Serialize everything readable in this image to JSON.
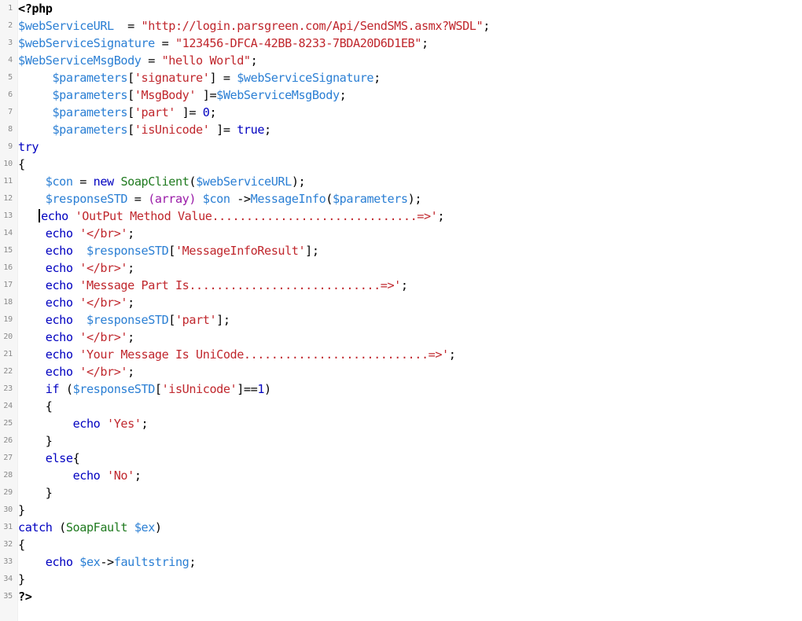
{
  "document": {
    "kind": "source-code-listing",
    "language": "PHP",
    "total_lines": 35,
    "caret_line": 13,
    "colors": {
      "background": "#ffffff",
      "gutter_background": "#f6f6f6",
      "line_number": "#8a8a8a",
      "variable": "#2b7fd4",
      "string": "#c0272d",
      "keyword": "#0000c0",
      "class_name": "#1f7a1f",
      "cast": "#9a1ba8",
      "plain": "#000000"
    }
  },
  "code": {
    "lines": [
      {
        "number": "1",
        "text": "<?php",
        "tokens": [
          {
            "t": "<?php",
            "c": "tok-tag"
          }
        ]
      },
      {
        "number": "2",
        "text": "$webServiceURL  = \"http://login.parsgreen.com/Api/SendSMS.asmx?WSDL\";",
        "tokens": [
          {
            "t": "$webServiceURL",
            "c": "tok-var"
          },
          {
            "t": "  = ",
            "c": "tok-plain"
          },
          {
            "t": "\"http://login.parsgreen.com/Api/SendSMS.asmx?WSDL\"",
            "c": "tok-string"
          },
          {
            "t": ";",
            "c": "tok-punc"
          }
        ]
      },
      {
        "number": "3",
        "text": "$webServiceSignature = \"123456-DFCA-42BB-8233-7BDA20D6D1EB\";",
        "tokens": [
          {
            "t": "$webServiceSignature",
            "c": "tok-var"
          },
          {
            "t": " = ",
            "c": "tok-plain"
          },
          {
            "t": "\"123456-DFCA-42BB-8233-7BDA20D6D1EB\"",
            "c": "tok-string"
          },
          {
            "t": ";",
            "c": "tok-punc"
          }
        ]
      },
      {
        "number": "4",
        "text": "$WebServiceMsgBody = \"hello World\";",
        "tokens": [
          {
            "t": "$WebServiceMsgBody",
            "c": "tok-var"
          },
          {
            "t": " = ",
            "c": "tok-plain"
          },
          {
            "t": "\"hello World\"",
            "c": "tok-string"
          },
          {
            "t": ";",
            "c": "tok-punc"
          }
        ]
      },
      {
        "number": "5",
        "text": "     $parameters['signature'] = $webServiceSignature;",
        "tokens": [
          {
            "t": "     ",
            "c": "tok-plain"
          },
          {
            "t": "$parameters",
            "c": "tok-var"
          },
          {
            "t": "[",
            "c": "tok-punc"
          },
          {
            "t": "'signature'",
            "c": "tok-string"
          },
          {
            "t": "] = ",
            "c": "tok-punc"
          },
          {
            "t": "$webServiceSignature",
            "c": "tok-var"
          },
          {
            "t": ";",
            "c": "tok-punc"
          }
        ]
      },
      {
        "number": "6",
        "text": "     $parameters['MsgBody' ]=$WebServiceMsgBody;",
        "tokens": [
          {
            "t": "     ",
            "c": "tok-plain"
          },
          {
            "t": "$parameters",
            "c": "tok-var"
          },
          {
            "t": "[",
            "c": "tok-punc"
          },
          {
            "t": "'MsgBody'",
            "c": "tok-string"
          },
          {
            "t": " ]=",
            "c": "tok-punc"
          },
          {
            "t": "$WebServiceMsgBody",
            "c": "tok-var"
          },
          {
            "t": ";",
            "c": "tok-punc"
          }
        ]
      },
      {
        "number": "7",
        "text": "     $parameters['part' ]= 0;",
        "tokens": [
          {
            "t": "     ",
            "c": "tok-plain"
          },
          {
            "t": "$parameters",
            "c": "tok-var"
          },
          {
            "t": "[",
            "c": "tok-punc"
          },
          {
            "t": "'part'",
            "c": "tok-string"
          },
          {
            "t": " ]= ",
            "c": "tok-punc"
          },
          {
            "t": "0",
            "c": "tok-number"
          },
          {
            "t": ";",
            "c": "tok-punc"
          }
        ]
      },
      {
        "number": "8",
        "text": "     $parameters['isUnicode' ]= true;",
        "tokens": [
          {
            "t": "     ",
            "c": "tok-plain"
          },
          {
            "t": "$parameters",
            "c": "tok-var"
          },
          {
            "t": "[",
            "c": "tok-punc"
          },
          {
            "t": "'isUnicode'",
            "c": "tok-string"
          },
          {
            "t": " ]= ",
            "c": "tok-punc"
          },
          {
            "t": "true",
            "c": "tok-const"
          },
          {
            "t": ";",
            "c": "tok-punc"
          }
        ]
      },
      {
        "number": "9",
        "text": "try",
        "tokens": [
          {
            "t": "try",
            "c": "tok-keyword"
          }
        ]
      },
      {
        "number": "10",
        "text": "{",
        "tokens": [
          {
            "t": "{",
            "c": "tok-punc"
          }
        ]
      },
      {
        "number": "11",
        "text": "    $con = new SoapClient($webServiceURL);",
        "tokens": [
          {
            "t": "    ",
            "c": "tok-plain"
          },
          {
            "t": "$con",
            "c": "tok-var"
          },
          {
            "t": " = ",
            "c": "tok-plain"
          },
          {
            "t": "new",
            "c": "tok-keyword"
          },
          {
            "t": " ",
            "c": "tok-plain"
          },
          {
            "t": "SoapClient",
            "c": "tok-class"
          },
          {
            "t": "(",
            "c": "tok-punc"
          },
          {
            "t": "$webServiceURL",
            "c": "tok-var"
          },
          {
            "t": ");",
            "c": "tok-punc"
          }
        ]
      },
      {
        "number": "12",
        "text": "    $responseSTD = (array) $con ->MessageInfo($parameters);",
        "tokens": [
          {
            "t": "    ",
            "c": "tok-plain"
          },
          {
            "t": "$responseSTD",
            "c": "tok-var"
          },
          {
            "t": " = ",
            "c": "tok-plain"
          },
          {
            "t": "(array)",
            "c": "tok-cast"
          },
          {
            "t": " ",
            "c": "tok-plain"
          },
          {
            "t": "$con",
            "c": "tok-var"
          },
          {
            "t": " ->",
            "c": "tok-punc"
          },
          {
            "t": "MessageInfo",
            "c": "tok-method"
          },
          {
            "t": "(",
            "c": "tok-punc"
          },
          {
            "t": "$parameters",
            "c": "tok-var"
          },
          {
            "t": ");",
            "c": "tok-punc"
          }
        ]
      },
      {
        "number": "13",
        "text": "    echo 'OutPut Method Value..............................=>';",
        "caret": true,
        "tokens": [
          {
            "t": "   ",
            "c": "tok-plain"
          },
          {
            "t": "echo",
            "c": "tok-keyword"
          },
          {
            "t": " ",
            "c": "tok-plain"
          },
          {
            "t": "'OutPut Method Value..............................=>'",
            "c": "tok-string"
          },
          {
            "t": ";",
            "c": "tok-punc"
          }
        ]
      },
      {
        "number": "14",
        "text": "    echo '</br>';",
        "tokens": [
          {
            "t": "    ",
            "c": "tok-plain"
          },
          {
            "t": "echo",
            "c": "tok-keyword"
          },
          {
            "t": " ",
            "c": "tok-plain"
          },
          {
            "t": "'</br>'",
            "c": "tok-string"
          },
          {
            "t": ";",
            "c": "tok-punc"
          }
        ]
      },
      {
        "number": "15",
        "text": "    echo  $responseSTD['MessageInfoResult'];",
        "tokens": [
          {
            "t": "    ",
            "c": "tok-plain"
          },
          {
            "t": "echo",
            "c": "tok-keyword"
          },
          {
            "t": "  ",
            "c": "tok-plain"
          },
          {
            "t": "$responseSTD",
            "c": "tok-var"
          },
          {
            "t": "[",
            "c": "tok-punc"
          },
          {
            "t": "'MessageInfoResult'",
            "c": "tok-string"
          },
          {
            "t": "];",
            "c": "tok-punc"
          }
        ]
      },
      {
        "number": "16",
        "text": "    echo '</br>';",
        "tokens": [
          {
            "t": "    ",
            "c": "tok-plain"
          },
          {
            "t": "echo",
            "c": "tok-keyword"
          },
          {
            "t": " ",
            "c": "tok-plain"
          },
          {
            "t": "'</br>'",
            "c": "tok-string"
          },
          {
            "t": ";",
            "c": "tok-punc"
          }
        ]
      },
      {
        "number": "17",
        "text": "    echo 'Message Part Is............................=>';",
        "tokens": [
          {
            "t": "    ",
            "c": "tok-plain"
          },
          {
            "t": "echo",
            "c": "tok-keyword"
          },
          {
            "t": " ",
            "c": "tok-plain"
          },
          {
            "t": "'Message Part Is............................=>'",
            "c": "tok-string"
          },
          {
            "t": ";",
            "c": "tok-punc"
          }
        ]
      },
      {
        "number": "18",
        "text": "    echo '</br>';",
        "tokens": [
          {
            "t": "    ",
            "c": "tok-plain"
          },
          {
            "t": "echo",
            "c": "tok-keyword"
          },
          {
            "t": " ",
            "c": "tok-plain"
          },
          {
            "t": "'</br>'",
            "c": "tok-string"
          },
          {
            "t": ";",
            "c": "tok-punc"
          }
        ]
      },
      {
        "number": "19",
        "text": "    echo  $responseSTD['part'];",
        "tokens": [
          {
            "t": "    ",
            "c": "tok-plain"
          },
          {
            "t": "echo",
            "c": "tok-keyword"
          },
          {
            "t": "  ",
            "c": "tok-plain"
          },
          {
            "t": "$responseSTD",
            "c": "tok-var"
          },
          {
            "t": "[",
            "c": "tok-punc"
          },
          {
            "t": "'part'",
            "c": "tok-string"
          },
          {
            "t": "];",
            "c": "tok-punc"
          }
        ]
      },
      {
        "number": "20",
        "text": "    echo '</br>';",
        "tokens": [
          {
            "t": "    ",
            "c": "tok-plain"
          },
          {
            "t": "echo",
            "c": "tok-keyword"
          },
          {
            "t": " ",
            "c": "tok-plain"
          },
          {
            "t": "'</br>'",
            "c": "tok-string"
          },
          {
            "t": ";",
            "c": "tok-punc"
          }
        ]
      },
      {
        "number": "21",
        "text": "    echo 'Your Message Is UniCode...........................=>';",
        "tokens": [
          {
            "t": "    ",
            "c": "tok-plain"
          },
          {
            "t": "echo",
            "c": "tok-keyword"
          },
          {
            "t": " ",
            "c": "tok-plain"
          },
          {
            "t": "'Your Message Is UniCode...........................=>'",
            "c": "tok-string"
          },
          {
            "t": ";",
            "c": "tok-punc"
          }
        ]
      },
      {
        "number": "22",
        "text": "    echo '</br>';",
        "tokens": [
          {
            "t": "    ",
            "c": "tok-plain"
          },
          {
            "t": "echo",
            "c": "tok-keyword"
          },
          {
            "t": " ",
            "c": "tok-plain"
          },
          {
            "t": "'</br>'",
            "c": "tok-string"
          },
          {
            "t": ";",
            "c": "tok-punc"
          }
        ]
      },
      {
        "number": "23",
        "text": "    if ($responseSTD['isUnicode']==1)",
        "tokens": [
          {
            "t": "    ",
            "c": "tok-plain"
          },
          {
            "t": "if",
            "c": "tok-keyword"
          },
          {
            "t": " (",
            "c": "tok-punc"
          },
          {
            "t": "$responseSTD",
            "c": "tok-var"
          },
          {
            "t": "[",
            "c": "tok-punc"
          },
          {
            "t": "'isUnicode'",
            "c": "tok-string"
          },
          {
            "t": "]==",
            "c": "tok-punc"
          },
          {
            "t": "1",
            "c": "tok-number"
          },
          {
            "t": ")",
            "c": "tok-punc"
          }
        ]
      },
      {
        "number": "24",
        "text": "    {",
        "tokens": [
          {
            "t": "    ",
            "c": "tok-plain"
          },
          {
            "t": "{",
            "c": "tok-punc"
          }
        ]
      },
      {
        "number": "25",
        "text": "        echo 'Yes';",
        "tokens": [
          {
            "t": "        ",
            "c": "tok-plain"
          },
          {
            "t": "echo",
            "c": "tok-keyword"
          },
          {
            "t": " ",
            "c": "tok-plain"
          },
          {
            "t": "'Yes'",
            "c": "tok-string"
          },
          {
            "t": ";",
            "c": "tok-punc"
          }
        ]
      },
      {
        "number": "26",
        "text": "    }",
        "tokens": [
          {
            "t": "    ",
            "c": "tok-plain"
          },
          {
            "t": "}",
            "c": "tok-punc"
          }
        ]
      },
      {
        "number": "27",
        "text": "    else{",
        "tokens": [
          {
            "t": "    ",
            "c": "tok-plain"
          },
          {
            "t": "else",
            "c": "tok-keyword"
          },
          {
            "t": "{",
            "c": "tok-punc"
          }
        ]
      },
      {
        "number": "28",
        "text": "        echo 'No';",
        "tokens": [
          {
            "t": "        ",
            "c": "tok-plain"
          },
          {
            "t": "echo",
            "c": "tok-keyword"
          },
          {
            "t": " ",
            "c": "tok-plain"
          },
          {
            "t": "'No'",
            "c": "tok-string"
          },
          {
            "t": ";",
            "c": "tok-punc"
          }
        ]
      },
      {
        "number": "29",
        "text": "    }",
        "tokens": [
          {
            "t": "    ",
            "c": "tok-plain"
          },
          {
            "t": "}",
            "c": "tok-punc"
          }
        ]
      },
      {
        "number": "30",
        "text": "}",
        "tokens": [
          {
            "t": "}",
            "c": "tok-punc"
          }
        ]
      },
      {
        "number": "31",
        "text": "catch (SoapFault $ex)",
        "tokens": [
          {
            "t": "catch",
            "c": "tok-keyword"
          },
          {
            "t": " (",
            "c": "tok-punc"
          },
          {
            "t": "SoapFault",
            "c": "tok-class"
          },
          {
            "t": " ",
            "c": "tok-plain"
          },
          {
            "t": "$ex",
            "c": "tok-var"
          },
          {
            "t": ")",
            "c": "tok-punc"
          }
        ]
      },
      {
        "number": "32",
        "text": "{",
        "tokens": [
          {
            "t": "{",
            "c": "tok-punc"
          }
        ]
      },
      {
        "number": "33",
        "text": "    echo $ex->faultstring;",
        "tokens": [
          {
            "t": "    ",
            "c": "tok-plain"
          },
          {
            "t": "echo",
            "c": "tok-keyword"
          },
          {
            "t": " ",
            "c": "tok-plain"
          },
          {
            "t": "$ex",
            "c": "tok-var"
          },
          {
            "t": "->",
            "c": "tok-punc"
          },
          {
            "t": "faultstring",
            "c": "tok-method"
          },
          {
            "t": ";",
            "c": "tok-punc"
          }
        ]
      },
      {
        "number": "34",
        "text": "}",
        "tokens": [
          {
            "t": "}",
            "c": "tok-punc"
          }
        ]
      },
      {
        "number": "35",
        "text": "?>",
        "tokens": [
          {
            "t": "?>",
            "c": "tok-tag"
          }
        ]
      }
    ]
  }
}
